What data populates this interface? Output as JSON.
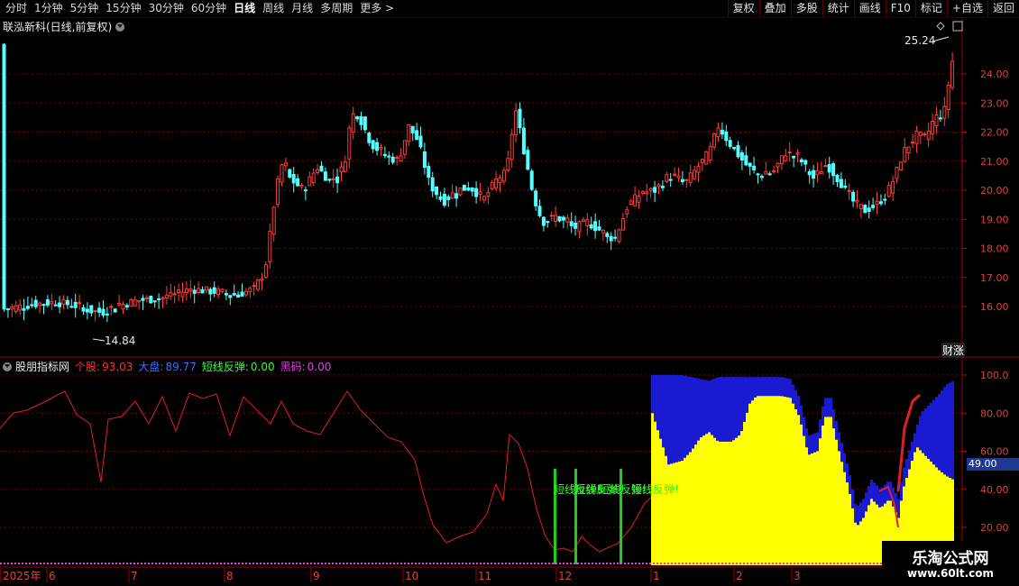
{
  "toolbar": {
    "periods": [
      "分时",
      "1分钟",
      "5分钟",
      "15分钟",
      "30分钟",
      "60分钟",
      "日线",
      "周线",
      "月线",
      "多周期",
      "更多 >"
    ],
    "active_period": "日线",
    "buttons": [
      "复权",
      "叠加",
      "多股",
      "统计",
      "画线",
      "F10",
      "标记",
      "+自选",
      "返回"
    ]
  },
  "chart_title": "联泓新科(日线,前复权)",
  "price_axis": {
    "labels": [
      "24.00",
      "23.00",
      "22.00",
      "21.00",
      "20.00",
      "19.00",
      "18.00",
      "17.00",
      "16.00"
    ]
  },
  "price_annotations": {
    "high": "25.24",
    "low": "14.84"
  },
  "caizhang": "财涨",
  "indicator": {
    "name": "股朋指标网",
    "items": [
      {
        "label": "个股:",
        "value": "93.03",
        "color": "#ff3030"
      },
      {
        "label": "大盘:",
        "value": "89.77",
        "color": "#3a6cff"
      },
      {
        "label": "短线反弹:",
        "value": "0.00",
        "color": "#30ff30"
      },
      {
        "label": "黑码:",
        "value": "0.00",
        "color": "#e040e0"
      }
    ],
    "axis_labels": [
      "100.0",
      "80.00",
      "60.00",
      "40.00",
      "20.00"
    ],
    "current_badge": "49.00",
    "signal_text": "短线反弹!"
  },
  "x_axis": {
    "labels": [
      "2025年",
      "6",
      "7",
      "8",
      "9",
      "10",
      "11",
      "12",
      "1",
      "2",
      "3"
    ]
  },
  "watermark": {
    "title": "乐淘公式网",
    "url": "www.60lt.com"
  },
  "colors": {
    "up": "#ff3c3c",
    "down": "#54ffff",
    "grid": "#7a0000",
    "yellow": "#ffff00",
    "blue": "#1a1ad0"
  }
}
